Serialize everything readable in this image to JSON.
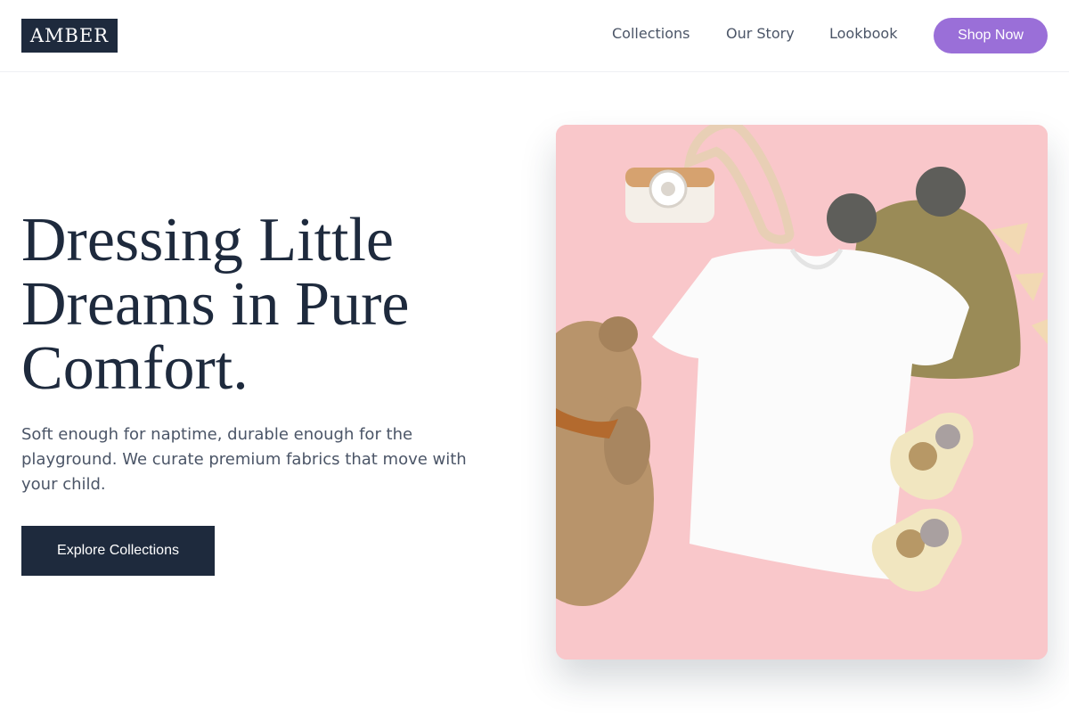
{
  "header": {
    "logo": "AMBER",
    "nav": [
      "Collections",
      "Our Story",
      "Lookbook"
    ],
    "shop_button": "Shop Now"
  },
  "hero": {
    "title": "Dressing Little Dreams in Pure Comfort.",
    "subtitle": "Soft enough for naptime, durable enough for the playground. We curate premium fabrics that move with your child.",
    "cta": "Explore Collections"
  },
  "colors": {
    "navy": "#1e2a3d",
    "accent": "#9a6fd8",
    "image_background": "#f9c7ca"
  }
}
